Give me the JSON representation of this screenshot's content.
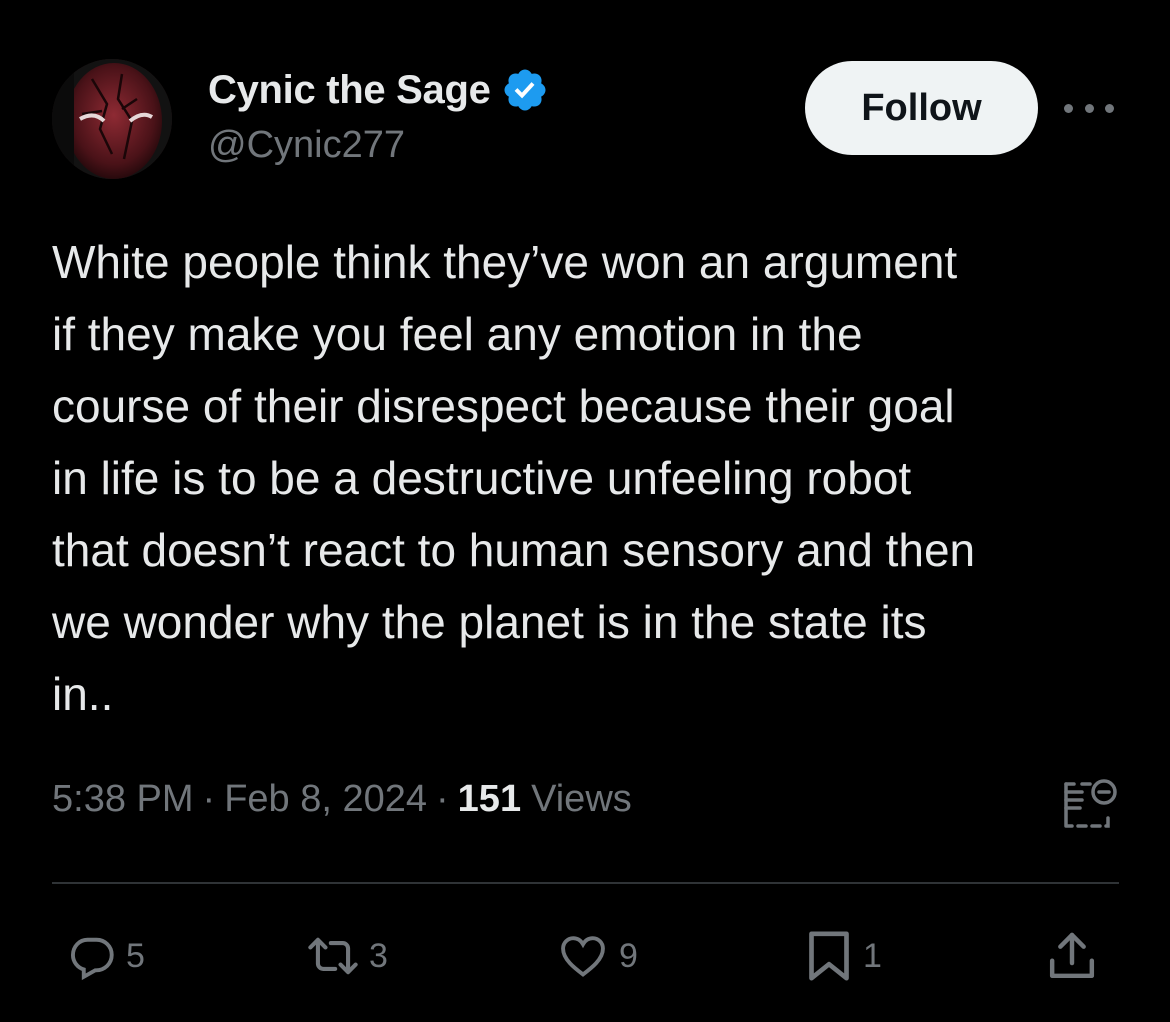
{
  "author": {
    "display_name": "Cynic the Sage",
    "handle": "@Cynic277",
    "verified": true,
    "verified_color": "#1d9bf0"
  },
  "header": {
    "follow_label": "Follow",
    "more_icon": "more-horizontal-icon"
  },
  "tweet": {
    "text_lines": [
      "White people think they’ve won an argument",
      "if they make you feel any emotion in the",
      "course of their disrespect because their goal",
      "in life is to be a destructive unfeeling robot",
      "that doesn’t react to human sensory and then",
      "we wonder why the planet is in the state its",
      "in.."
    ]
  },
  "meta": {
    "time": "5:38 PM",
    "separator": "·",
    "date": "Feb 8, 2024",
    "views_count": "151",
    "views_label": "Views"
  },
  "actions": {
    "replies": "5",
    "reposts": "3",
    "likes": "9",
    "bookmarks": "1"
  },
  "colors": {
    "background": "#000000",
    "primary_text": "#e7e9ea",
    "secondary_text": "#71767b",
    "divider": "#2f3336",
    "follow_bg": "#eff3f4"
  }
}
